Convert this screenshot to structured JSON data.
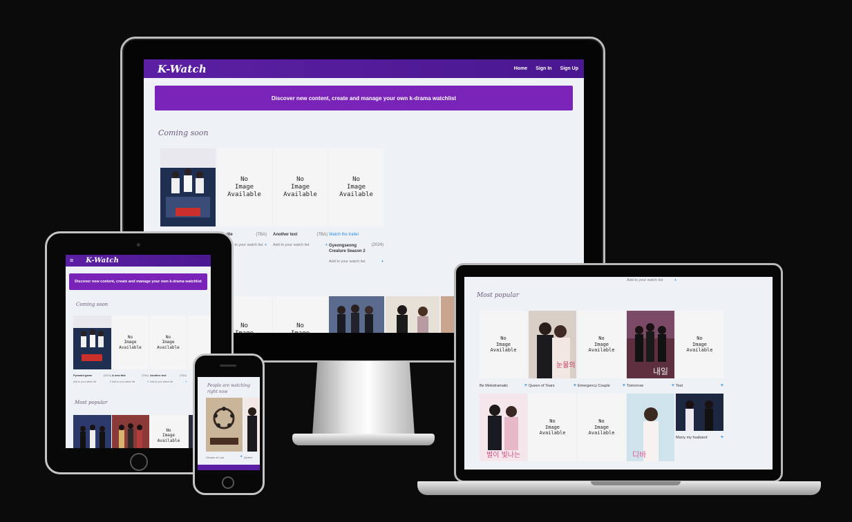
{
  "brand": {
    "logo": "K-Watch",
    "accent": "#7a23b8",
    "nav_bg": "#4a1890",
    "link": "#2a8de0"
  },
  "nav": {
    "home": "Home",
    "sign_in": "Sign In",
    "sign_up": "Sign Up",
    "menu_icon": "menu-icon"
  },
  "banner": "Discover new content, create and manage your own k-drama watchlist",
  "sections": {
    "coming_soon": "Coming soon",
    "most_popular": "Most popular",
    "watching_now": "People are watching right now"
  },
  "common": {
    "no_image": "No\nImage\nAvailable",
    "add_to_watchlist": "Add to your watch list",
    "watch_trailer": "Watch the trailer",
    "plus": "+"
  },
  "desktop": {
    "coming_soon": [
      {
        "title": "itle",
        "year": "(TBA)"
      },
      {
        "title": "Another text",
        "year": "(TBA)"
      },
      {
        "title": "Gyeongseong Creature Season 2",
        "year": "(2024)"
      }
    ]
  },
  "laptop": {
    "most_popular_row1": [
      {
        "title": "Be Melodramatic"
      },
      {
        "title": "Queen of Tears"
      },
      {
        "title": "Emergency Couple"
      },
      {
        "title": "Tomorrow"
      },
      {
        "title": "Test"
      }
    ],
    "most_popular_row2": [
      {
        "title": "Marry my husband"
      }
    ]
  },
  "tablet": {
    "coming_soon": [
      {
        "title": "Pyramid game",
        "year": "(2024)"
      },
      {
        "title": "A new title",
        "year": "(TBA)"
      },
      {
        "title": "Another text",
        "year": "(TBA)"
      }
    ]
  },
  "phone": {
    "card": {
      "title": "Ghosts of Lola",
      "next": "Queen"
    }
  }
}
